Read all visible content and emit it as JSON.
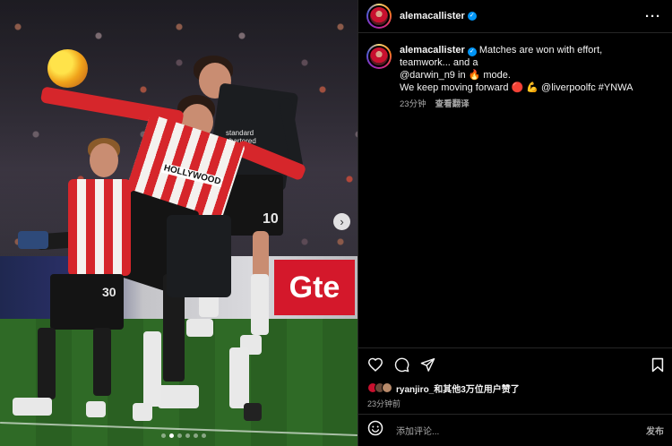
{
  "post": {
    "username": "alemacallister",
    "verified": true,
    "caption_line1_pre": "Matches are won with effort, teamwork... and a",
    "caption_line2_mention": "@darwin_n9",
    "caption_line2_mid": " in ",
    "caption_line2_fire": "🔥",
    "caption_line2_post": " mode.",
    "caption_line3_pre": "We keep moving forward ",
    "caption_line3_emoji": "🔴 💪 ",
    "caption_line3_mention": "@liverpoolfc",
    "caption_line3_tag": " #YNWA",
    "time_ago": "23分钟",
    "see_translation": "查看翻译"
  },
  "media": {
    "ad_board_text": "Gte",
    "slide_count": 6,
    "active_slide": 2,
    "sponsor_shirt_red": "HOLLYWOOD",
    "sponsor_shirt_black": "standard chartered",
    "player_numbers": [
      "10",
      "30"
    ]
  },
  "engagement": {
    "likes_user": "ryanjiro_",
    "likes_suffix": "和其他3万位用户赞了",
    "time_full": "23分钟前"
  },
  "comment": {
    "placeholder": "添加评论...",
    "post_label": "发布"
  },
  "colors": {
    "background": "#000000",
    "accent": "#0095f6",
    "muted": "#a8a8a8"
  }
}
